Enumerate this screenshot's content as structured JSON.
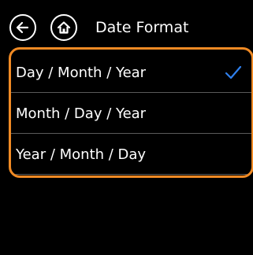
{
  "header": {
    "back_icon": "arrow-left-icon",
    "home_icon": "home-icon",
    "title": "Date Format"
  },
  "options": [
    {
      "label": "Day / Month / Year",
      "selected": true
    },
    {
      "label": "Month / Day / Year",
      "selected": false
    },
    {
      "label": "Year / Month / Day",
      "selected": false
    }
  ],
  "colors": {
    "background": "#000000",
    "text": "#ffffff",
    "highlight_border": "#f08a24",
    "check": "#2f80ed",
    "divider": "#5a5a5a"
  },
  "check_icon": "checkmark-icon"
}
